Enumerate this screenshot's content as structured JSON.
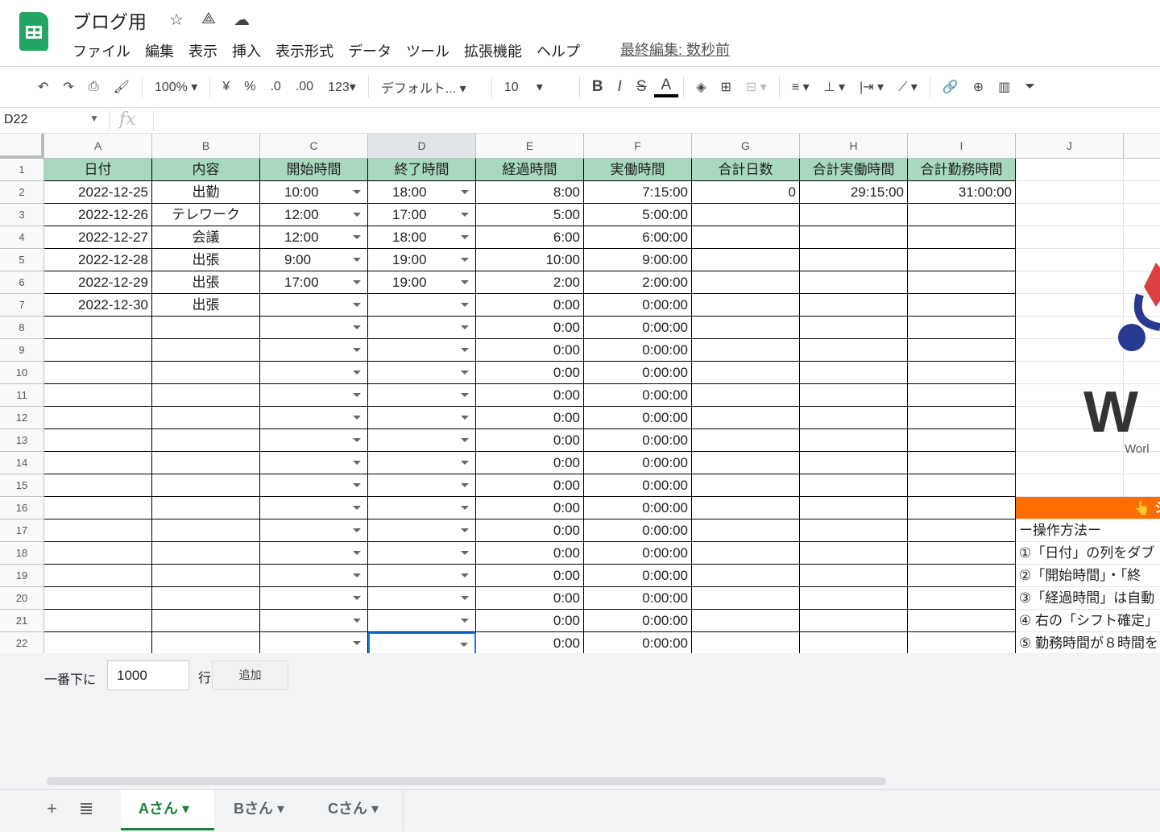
{
  "app": {
    "title": "ブログ用",
    "last_edit": "最終編集: 数秒前",
    "menu": [
      "ファイル",
      "編集",
      "表示",
      "挿入",
      "表示形式",
      "データ",
      "ツール",
      "拡張機能",
      "ヘルプ"
    ]
  },
  "toolbar": {
    "zoom": "100%",
    "currency": "¥",
    "percent": "%",
    "dec_less": ".0",
    "dec_more": ".00",
    "format": "123",
    "font": "デフォルト...",
    "size": "10",
    "bold": "B",
    "italic": "I",
    "strike": "S",
    "text_color": "A"
  },
  "formula": {
    "cell_ref": "D22",
    "fx": "fx",
    "content": ""
  },
  "columns": [
    "A",
    "B",
    "C",
    "D",
    "E",
    "F",
    "G",
    "H",
    "I",
    "J"
  ],
  "headers": [
    "日付",
    "内容",
    "開始時間",
    "終了時間",
    "経過時間",
    "実働時間",
    "合計日数",
    "合計実働時間",
    "合計勤務時間"
  ],
  "rows": [
    [
      "2022-12-25",
      "出勤",
      "10:00",
      "18:00",
      "8:00",
      "7:15:00",
      "0",
      "29:15:00",
      "31:00:00"
    ],
    [
      "2022-12-26",
      "テレワーク",
      "12:00",
      "17:00",
      "5:00",
      "5:00:00",
      "",
      "",
      ""
    ],
    [
      "2022-12-27",
      "会議",
      "12:00",
      "18:00",
      "6:00",
      "6:00:00",
      "",
      "",
      ""
    ],
    [
      "2022-12-28",
      "出張",
      "9:00",
      "19:00",
      "10:00",
      "9:00:00",
      "",
      "",
      ""
    ],
    [
      "2022-12-29",
      "出張",
      "17:00",
      "19:00",
      "2:00",
      "2:00:00",
      "",
      "",
      ""
    ],
    [
      "2022-12-30",
      "出張",
      "",
      "",
      "0:00",
      "0:00:00",
      "",
      "",
      ""
    ],
    [
      "",
      "",
      "",
      "",
      "0:00",
      "0:00:00",
      "",
      "",
      ""
    ],
    [
      "",
      "",
      "",
      "",
      "0:00",
      "0:00:00",
      "",
      "",
      ""
    ],
    [
      "",
      "",
      "",
      "",
      "0:00",
      "0:00:00",
      "",
      "",
      ""
    ],
    [
      "",
      "",
      "",
      "",
      "0:00",
      "0:00:00",
      "",
      "",
      ""
    ],
    [
      "",
      "",
      "",
      "",
      "0:00",
      "0:00:00",
      "",
      "",
      ""
    ],
    [
      "",
      "",
      "",
      "",
      "0:00",
      "0:00:00",
      "",
      "",
      ""
    ],
    [
      "",
      "",
      "",
      "",
      "0:00",
      "0:00:00",
      "",
      "",
      ""
    ],
    [
      "",
      "",
      "",
      "",
      "0:00",
      "0:00:00",
      "",
      "",
      ""
    ],
    [
      "",
      "",
      "",
      "",
      "0:00",
      "0:00:00",
      "",
      "",
      ""
    ],
    [
      "",
      "",
      "",
      "",
      "0:00",
      "0:00:00",
      "",
      "",
      ""
    ],
    [
      "",
      "",
      "",
      "",
      "0:00",
      "0:00:00",
      "",
      "",
      ""
    ],
    [
      "",
      "",
      "",
      "",
      "0:00",
      "0:00:00",
      "",
      "",
      ""
    ],
    [
      "",
      "",
      "",
      "",
      "0:00",
      "0:00:00",
      "",
      "",
      ""
    ],
    [
      "",
      "",
      "",
      "",
      "0:00",
      "0:00:00",
      "",
      "",
      ""
    ],
    [
      "",
      "",
      "",
      "",
      "0:00",
      "0:00:00",
      "",
      "",
      ""
    ]
  ],
  "side_notes": {
    "banner": "👆 シ",
    "logo_text": "Worl",
    "lines": [
      "ー操作方法ー",
      "①「日付」の列をダブ",
      "②「開始時間」・「終",
      "③「経過時間」は自動",
      "④ 右の「シフト確定」",
      "⑤ 勤務時間が８時間を"
    ]
  },
  "add_rows": {
    "label": "一番下に",
    "value": "1000",
    "unit": "行",
    "button": "追加"
  },
  "sheets": [
    "Aさん",
    "Bさん",
    "Cさん"
  ],
  "colors": {
    "header_bg": "#a8d8bd",
    "banner": "#ff6d01",
    "accent": "#188038"
  }
}
